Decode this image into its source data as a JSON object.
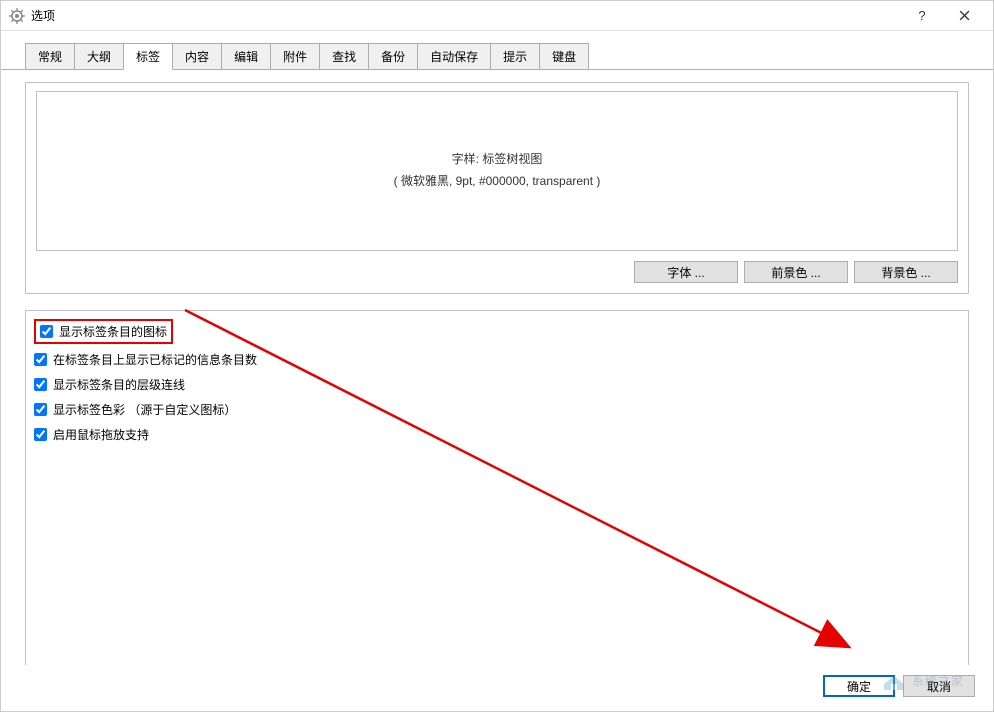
{
  "window": {
    "title": "选项"
  },
  "tabs": [
    {
      "label": "常规",
      "active": false
    },
    {
      "label": "大纲",
      "active": false
    },
    {
      "label": "标签",
      "active": true
    },
    {
      "label": "内容",
      "active": false
    },
    {
      "label": "编辑",
      "active": false
    },
    {
      "label": "附件",
      "active": false
    },
    {
      "label": "查找",
      "active": false
    },
    {
      "label": "备份",
      "active": false
    },
    {
      "label": "自动保存",
      "active": false
    },
    {
      "label": "提示",
      "active": false
    },
    {
      "label": "键盘",
      "active": false
    }
  ],
  "preview": {
    "line1": "字样:  标签树视图",
    "line2": "( 微软雅黑, 9pt, #000000, transparent )"
  },
  "buttons": {
    "font": "字体 ...",
    "foreground": "前景色 ...",
    "background": "背景色 ..."
  },
  "checkboxes": [
    {
      "label": "显示标签条目的图标",
      "checked": true,
      "highlighted": true
    },
    {
      "label": "在标签条目上显示已标记的信息条目数",
      "checked": true,
      "highlighted": false
    },
    {
      "label": "显示标签条目的层级连线",
      "checked": true,
      "highlighted": false
    },
    {
      "label": "显示标签色彩 （源于自定义图标）",
      "checked": true,
      "highlighted": false
    },
    {
      "label": "启用鼠标拖放支持",
      "checked": true,
      "highlighted": false
    }
  ],
  "footer": {
    "ok": "确定",
    "cancel": "取消"
  },
  "watermark": "系统之家"
}
